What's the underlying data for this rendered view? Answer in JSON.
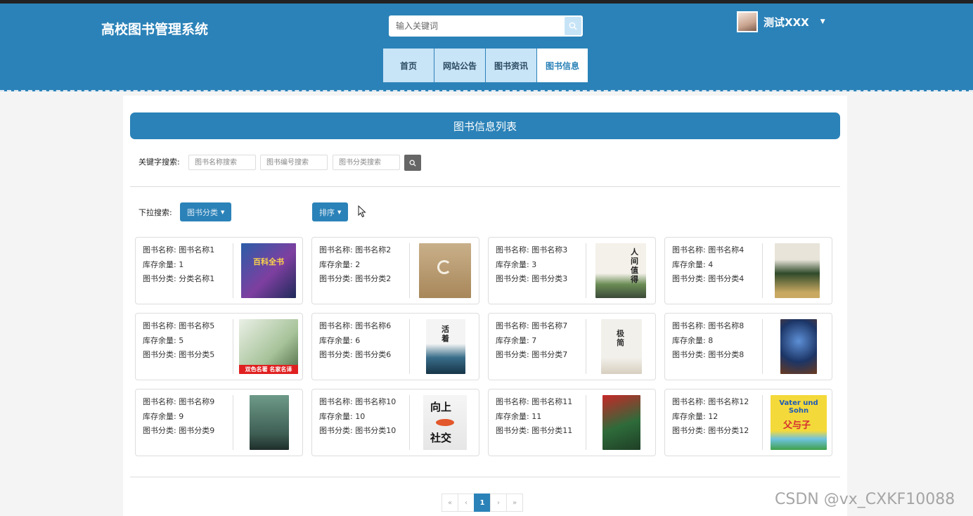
{
  "site": {
    "title": "高校图书管理系统"
  },
  "search": {
    "placeholder": "输入关键词"
  },
  "user": {
    "name": "测试XXX"
  },
  "nav": [
    {
      "label": "首页"
    },
    {
      "label": "网站公告"
    },
    {
      "label": "图书资讯"
    },
    {
      "label": "图书信息"
    }
  ],
  "list": {
    "title": "图书信息列表",
    "keyword_label": "关键字搜索:",
    "name_placeholder": "图书名称搜索",
    "code_placeholder": "图书编号搜索",
    "category_placeholder": "图书分类搜索",
    "dropdown_label": "下拉搜索:",
    "category_button": "图书分类",
    "sort_button": "排序"
  },
  "fields": {
    "name": "图书名称: ",
    "stock": "库存余量: ",
    "category": "图书分类: "
  },
  "books": [
    {
      "name": "图书名称1",
      "stock": "1",
      "category": "分类名称1"
    },
    {
      "name": "图书名称2",
      "stock": "2",
      "category": "图书分类2"
    },
    {
      "name": "图书名称3",
      "stock": "3",
      "category": "图书分类3"
    },
    {
      "name": "图书名称4",
      "stock": "4",
      "category": "图书分类4"
    },
    {
      "name": "图书名称5",
      "stock": "5",
      "category": "图书分类5"
    },
    {
      "name": "图书名称6",
      "stock": "6",
      "category": "图书分类6"
    },
    {
      "name": "图书名称7",
      "stock": "7",
      "category": "图书分类7"
    },
    {
      "name": "图书名称8",
      "stock": "8",
      "category": "图书分类8"
    },
    {
      "name": "图书名称9",
      "stock": "9",
      "category": "图书分类9"
    },
    {
      "name": "图书名称10",
      "stock": "10",
      "category": "图书分类10"
    },
    {
      "name": "图书名称11",
      "stock": "11",
      "category": "图书分类11"
    },
    {
      "name": "图书名称12",
      "stock": "12",
      "category": "图书分类12"
    }
  ],
  "covers": {
    "c1": "百科全书",
    "c3": "人间值得",
    "c5": "双色名著 名家名译",
    "c6": "活着",
    "c7": "极简",
    "c10a": "向上",
    "c10b": "社交",
    "c12a": "Vater und Sohn",
    "c12b": "父与子"
  },
  "pagination": {
    "first": "«",
    "prev": "‹",
    "current": "1",
    "next": "›",
    "last": "»"
  },
  "watermark": "CSDN @vx_CXKF10088"
}
